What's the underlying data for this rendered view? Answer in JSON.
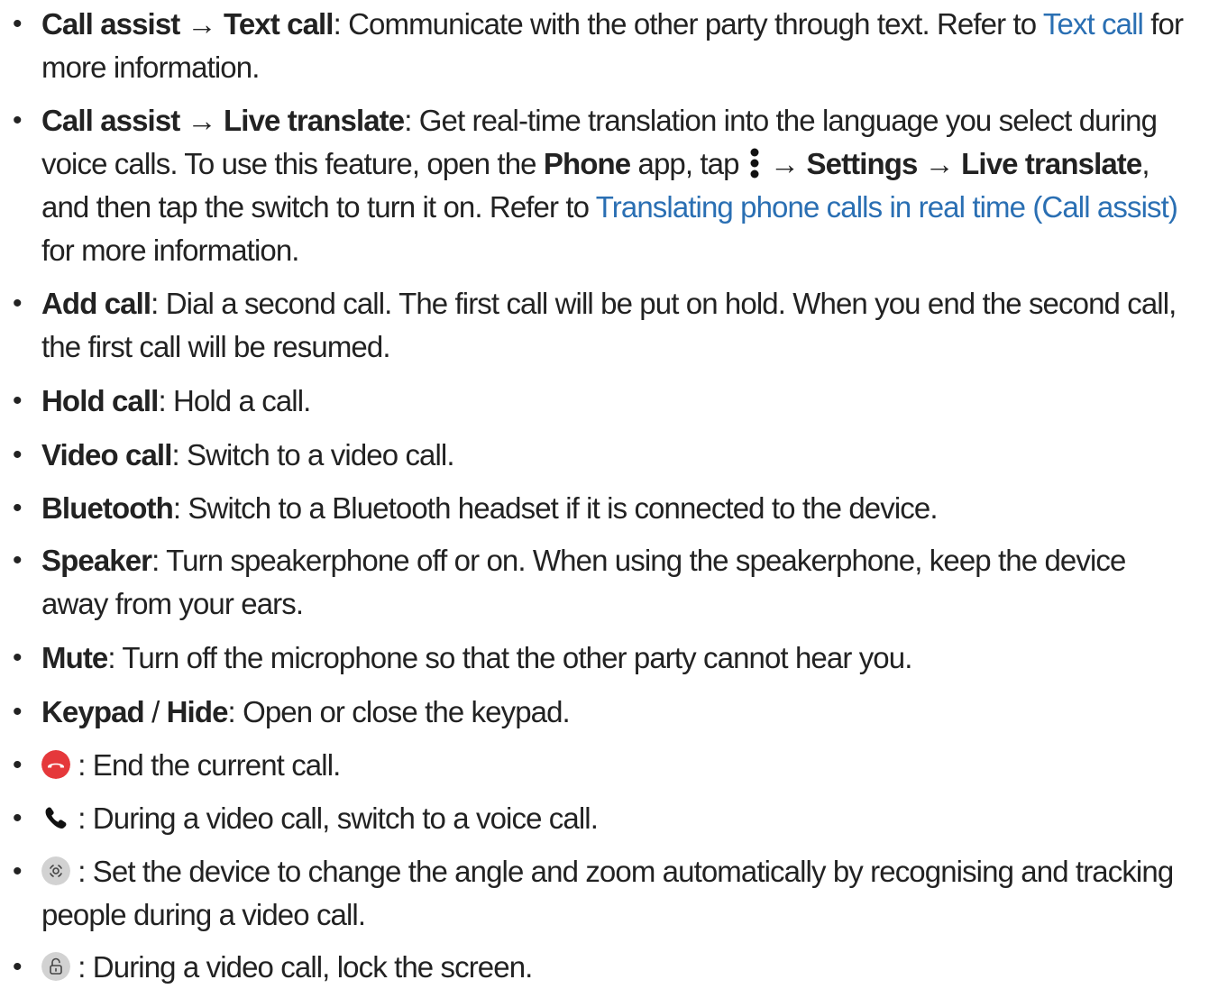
{
  "bullet": "•",
  "arrow": "→",
  "colon": ":",
  "items": [
    {
      "a": "Call assist",
      "b": "Text call",
      "desc": ": Communicate with the other party through text. Refer to ",
      "link": "Text call",
      "tail": " for more information."
    },
    {
      "a": "Call assist",
      "b": "Live translate",
      "desc1": ": Get real-time translation into the language you select during voice calls. To use this feature, open the ",
      "app": "Phone",
      "desc2": " app, tap ",
      "settings": "Settings",
      "live": "Live translate",
      "desc3": ", and then tap the switch to turn it on. Refer to ",
      "link": "Translating phone calls in real time (Call assist)",
      "tail": " for more information."
    },
    {
      "label": "Add call",
      "desc": ": Dial a second call. The first call will be put on hold. When you end the second call, the first call will be resumed."
    },
    {
      "label": "Hold call",
      "desc": ": Hold a call."
    },
    {
      "label": "Video call",
      "desc": ": Switch to a video call."
    },
    {
      "label": "Bluetooth",
      "desc": ": Switch to a Bluetooth headset if it is connected to the device."
    },
    {
      "label": "Speaker",
      "desc": ": Turn speakerphone off or on. When using the speakerphone, keep the device away from your ears."
    },
    {
      "label": "Mute",
      "desc": ": Turn off the microphone so that the other party cannot hear you."
    },
    {
      "label1": "Keypad",
      "sep": " / ",
      "label2": "Hide",
      "desc": ": Open or close the keypad."
    },
    {
      "icon": "end-call-icon",
      "desc": " : End the current call."
    },
    {
      "icon": "phone-icon",
      "desc": " : During a video call, switch to a voice call."
    },
    {
      "icon": "auto-framing-icon",
      "desc": " : Set the device to change the angle and zoom automatically by recognising and tracking people during a video call."
    },
    {
      "icon": "lock-icon",
      "desc": " : During a video call, lock the screen."
    }
  ],
  "colors": {
    "text": "#222222",
    "link": "#2a6fb3",
    "end_call": "#e5383b",
    "icon_gray": "#cfcfcf"
  }
}
